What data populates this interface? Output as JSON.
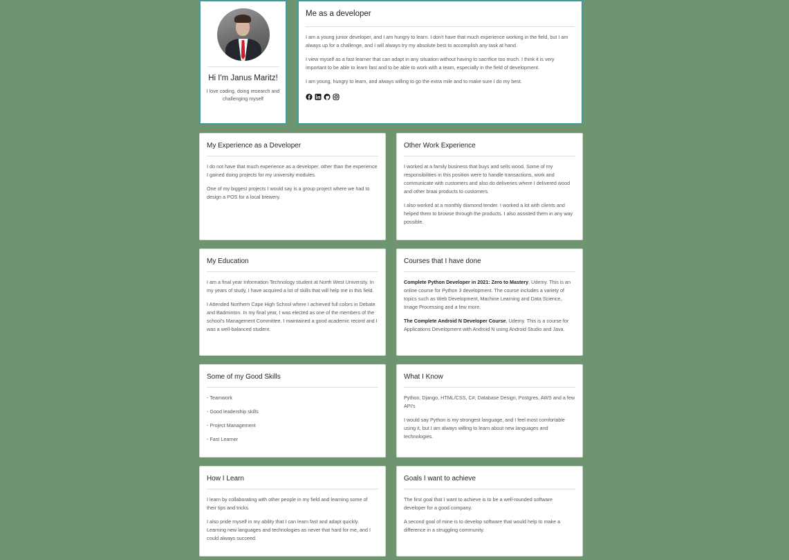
{
  "profile": {
    "greeting": "Hi I'm Janus Maritz!",
    "tagline": "I love coding, doing research and challenging myself"
  },
  "developer": {
    "title": "Me as a developer",
    "paragraphs": [
      "I am a young junior developer, and I am hungry to learn. I don't have that much experience working in the field, but I am always up for a challenge, and I will always try my absolute best to accomplish any task at hand.",
      "I view myself as a fast learner that can adapt in any situation without having to sacrifice too much. I think it is very important to be able to learn fast and to be able to work with a team, especially in the field of development.",
      "I am young, hungry to learn, and always willing to go the extra mile and to make sure I do my best."
    ],
    "social_icons": [
      "facebook-icon",
      "linkedin-icon",
      "github-icon",
      "instagram-icon"
    ]
  },
  "experience": {
    "title": "My Experience as a Developer",
    "paragraphs": [
      "I do not have that much experience as a developer, other than the experience I gained doing projects for my university modules.",
      "One of my biggest projects I would say is a group project where we had to design a POS for a local brewery."
    ]
  },
  "other_work": {
    "title": "Other Work Experience",
    "paragraphs": [
      "I worked at a family business that buys and sells wood. Some of my responsibilities in this position were to handle transactions, work and communicate with customers and also do deliveries where I delivered wood and other braai products to customers.",
      "I also worked at a monthly diamond tender. I worked a lot with clients and helped them to browse through the products. I also assisted them in any way possible."
    ]
  },
  "education": {
    "title": "My Education",
    "paragraphs": [
      "I am a final year Information Technology student at North West University. In my years of study, I have acquired a lot of skills that will help me in this field.",
      "I Attended Northern Cape High School where I achieved full colors in Debate and Badminton. In my final year, I was elected as one of the members of the school's Management Committee. I maintained a good academic record and I was a well-balanced student."
    ]
  },
  "courses": {
    "title": "Courses that I have done",
    "items": [
      {
        "name": "Complete Python Developer in 2021: Zero to Mastery",
        "text": ", Udemy. This is an online course for Python 3 development. The course includes a variety of topics such as Web Development, Machine Learning and Data Science, Image Processing and a few more."
      },
      {
        "name": "The Complete Android N Developer Course",
        "text": ", Udemy. This is a course for Applications Development with Android N using Android Studio and Java."
      }
    ]
  },
  "skills": {
    "title": "Some of my Good Skills",
    "items": [
      "- Teamwork",
      "- Good leadership skills",
      "- Project Management",
      "- Fast Learner"
    ]
  },
  "know": {
    "title": "What I Know",
    "paragraphs": [
      "Python, Django, HTML/CSS, C#, Database Design, Postgres, AWS and a few API's",
      "I would say Python is my strongest language, and I feel most comfortable using it, but I am always willing to learn about new languages and technologies."
    ]
  },
  "learn": {
    "title": "How I Learn",
    "paragraphs": [
      "I learn by collaborating with other people in my field and learning some of their tips and tricks.",
      "I also pride myself in my ability that I can learn fast and adapt quickly. Learning new languages and technologies as never that hard for me, and I could always succeed."
    ]
  },
  "goals": {
    "title": "Goals I want to achieve",
    "paragraphs": [
      "The first goal that I want to achieve is to be a well-rounded software developer for a good company.",
      "A second goal of mine is to develop software that would help to make a difference in a struggling community."
    ]
  }
}
